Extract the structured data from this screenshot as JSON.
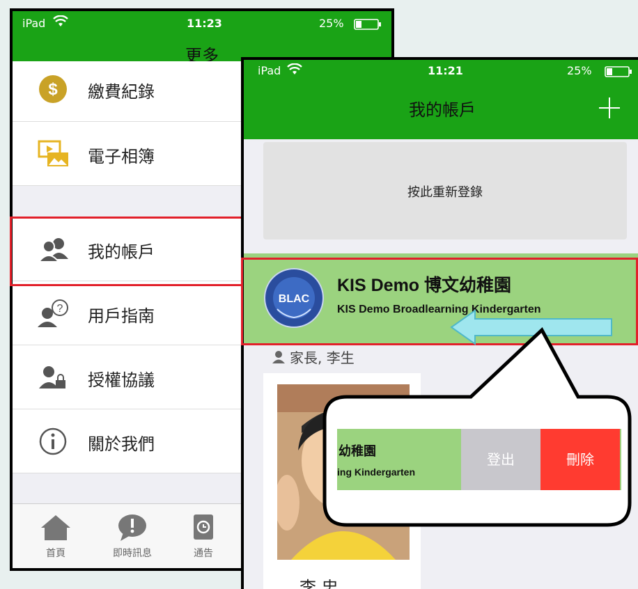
{
  "left_screen": {
    "status": {
      "carrier": "iPad",
      "time": "11:23",
      "battery": "25%"
    },
    "title": "更多",
    "menu": [
      {
        "label": "繳費紀錄",
        "icon": "dollar-coin-icon"
      },
      {
        "label": "電子相簿",
        "icon": "photo-album-icon"
      },
      {
        "label": "我的帳戶",
        "icon": "users-icon"
      },
      {
        "label": "用戶指南",
        "icon": "user-help-icon"
      },
      {
        "label": "授權協議",
        "icon": "user-lock-icon"
      },
      {
        "label": "關於我們",
        "icon": "info-icon"
      }
    ],
    "tabs": [
      {
        "label": "首頁",
        "icon": "home-icon"
      },
      {
        "label": "即時訊息",
        "icon": "chat-alert-icon"
      },
      {
        "label": "通告",
        "icon": "notice-icon"
      }
    ]
  },
  "right_screen": {
    "status": {
      "carrier": "iPad",
      "time": "11:21",
      "battery": "25%"
    },
    "title": "我的帳戶",
    "add_icon": "plus-icon",
    "relogin_label": "按此重新登錄",
    "school": {
      "logo_text": "BLAC",
      "name": "KIS Demo 博文幼稚園",
      "name_en": "KIS Demo Broadlearning Kindergarten"
    },
    "parent": "家長, 李生",
    "child_name": "李 忠"
  },
  "callout": {
    "school_fragment": "幼稚園",
    "school_en_fragment": "ing Kindergarten",
    "logout_label": "登出",
    "delete_label": "刪除"
  },
  "colors": {
    "green": "#1aa316",
    "light_green": "#9bd37f",
    "red": "#ff3b30",
    "highlight": "#e2202a",
    "arrow": "#9fe6ee"
  }
}
